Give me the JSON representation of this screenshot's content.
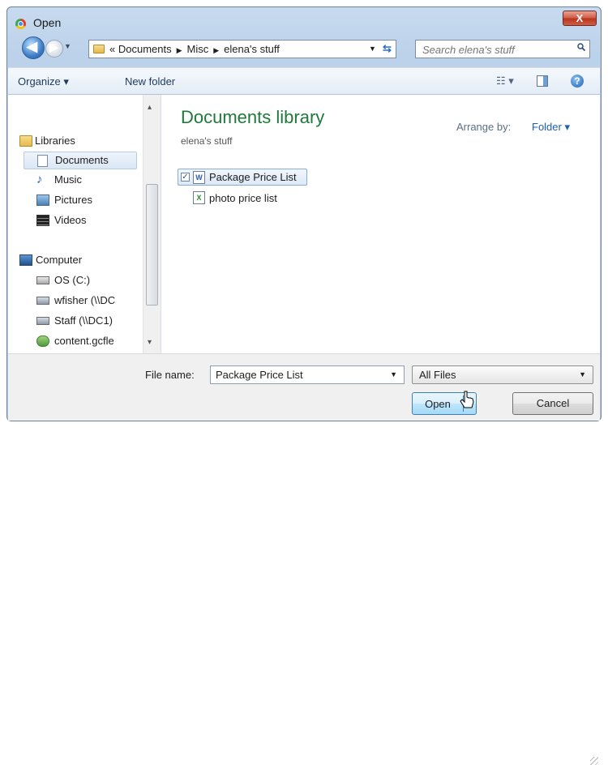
{
  "window": {
    "title": "Open",
    "close_glyph": "X"
  },
  "nav": {
    "back_glyph": "◀",
    "forward_glyph": "▶",
    "breadcrumb": {
      "prefix": "«",
      "items": [
        "Documents",
        "Misc",
        "elena's stuff"
      ],
      "sep": "▶"
    },
    "search_placeholder": "Search elena's stuff"
  },
  "toolbar": {
    "organize": "Organize ▾",
    "new_folder": "New folder",
    "help": "?",
    "views": "☷ ▾"
  },
  "sidebar": {
    "items": [
      {
        "label": "Libraries"
      },
      {
        "label": "Documents"
      },
      {
        "label": "Music"
      },
      {
        "label": "Pictures"
      },
      {
        "label": "Videos"
      },
      {
        "label": "Computer"
      },
      {
        "label": "OS (C:)"
      },
      {
        "label": "wfisher (\\\\DC"
      },
      {
        "label": "Staff (\\\\DC1)"
      },
      {
        "label": "content.gcfle"
      }
    ],
    "scroll_up": "▴",
    "scroll_down": "▾"
  },
  "content": {
    "library_title": "Documents library",
    "library_subtitle": "elena's stuff",
    "arrange_label": "Arrange by:",
    "arrange_value": "Folder ▾",
    "files": [
      {
        "name": "Package Price List",
        "type_badge": "W",
        "selected": true
      },
      {
        "name": "photo price list",
        "type_badge": "X",
        "selected": false
      }
    ]
  },
  "footer": {
    "filename_label": "File name:",
    "filename_value": "Package Price List",
    "filetype_value": "All Files",
    "open_label": "Open",
    "cancel_label": "Cancel"
  },
  "colors": {
    "accent_green": "#1f7a3a",
    "link_blue": "#1d5fb5",
    "selection": "#dce9f7"
  }
}
